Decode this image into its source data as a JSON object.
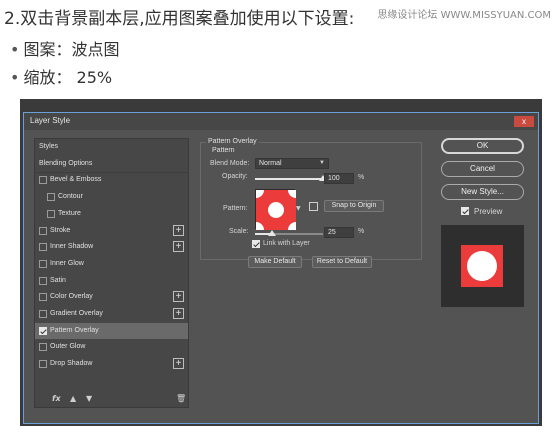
{
  "article": {
    "heading": "2.双击背景副本层,应用图案叠加使用以下设置:",
    "bullets": [
      {
        "dot": "•",
        "text": "图案：波点图"
      },
      {
        "dot": "•",
        "text": "缩放： 25%"
      }
    ],
    "watermark": "思缘设计论坛 WWW.MISSYUAN.COM"
  },
  "dialog": {
    "title": "Layer Style",
    "close_glyph": "x",
    "styles_list": [
      {
        "label": "Styles",
        "checkbox": false,
        "checked": false,
        "plus": false,
        "indent": 0
      },
      {
        "label": "Blending Options",
        "checkbox": false,
        "checked": false,
        "plus": false,
        "indent": 0
      },
      {
        "label": "Bevel & Emboss",
        "checkbox": true,
        "checked": false,
        "plus": false,
        "indent": 0
      },
      {
        "label": "Contour",
        "checkbox": true,
        "checked": false,
        "plus": false,
        "indent": 1
      },
      {
        "label": "Texture",
        "checkbox": true,
        "checked": false,
        "plus": false,
        "indent": 1
      },
      {
        "label": "Stroke",
        "checkbox": true,
        "checked": false,
        "plus": true,
        "indent": 0
      },
      {
        "label": "Inner Shadow",
        "checkbox": true,
        "checked": false,
        "plus": true,
        "indent": 0
      },
      {
        "label": "Inner Glow",
        "checkbox": true,
        "checked": false,
        "plus": false,
        "indent": 0
      },
      {
        "label": "Satin",
        "checkbox": true,
        "checked": false,
        "plus": false,
        "indent": 0
      },
      {
        "label": "Color Overlay",
        "checkbox": true,
        "checked": false,
        "plus": true,
        "indent": 0
      },
      {
        "label": "Gradient Overlay",
        "checkbox": true,
        "checked": false,
        "plus": true,
        "indent": 0
      },
      {
        "label": "Pattern Overlay",
        "checkbox": true,
        "checked": true,
        "plus": false,
        "indent": 0,
        "selected": true
      },
      {
        "label": "Outer Glow",
        "checkbox": true,
        "checked": false,
        "plus": false,
        "indent": 0
      },
      {
        "label": "Drop Shadow",
        "checkbox": true,
        "checked": false,
        "plus": true,
        "indent": 0
      }
    ],
    "bottom_icons": {
      "fx": "fx",
      "up": "▲",
      "down": "▼",
      "trash": "🗑"
    },
    "pattern_overlay": {
      "group_title": "Pattern Overlay",
      "subtitle": "Pattern",
      "blend_mode_label": "Blend Mode:",
      "blend_mode_value": "Normal",
      "opacity_label": "Opacity:",
      "opacity_value": "100",
      "opacity_unit": "%",
      "opacity_level": 1.0,
      "pattern_label": "Pattern:",
      "snap_button": "Snap to Origin",
      "scale_label": "Scale:",
      "scale_value": "25",
      "scale_unit": "%",
      "scale_level": 0.25,
      "link_label": "Link with Layer",
      "link_checked": true,
      "make_default": "Make Default",
      "reset_default": "Reset to Default"
    },
    "right": {
      "ok": "OK",
      "cancel": "Cancel",
      "new_style": "New Style...",
      "preview_label": "Preview",
      "preview_checked": true
    },
    "colors": {
      "pattern_red": "#ec3b3b",
      "pattern_dot": "#ffffff",
      "dialog_bg": "#535353",
      "accent_border": "#6aa0d8"
    }
  }
}
